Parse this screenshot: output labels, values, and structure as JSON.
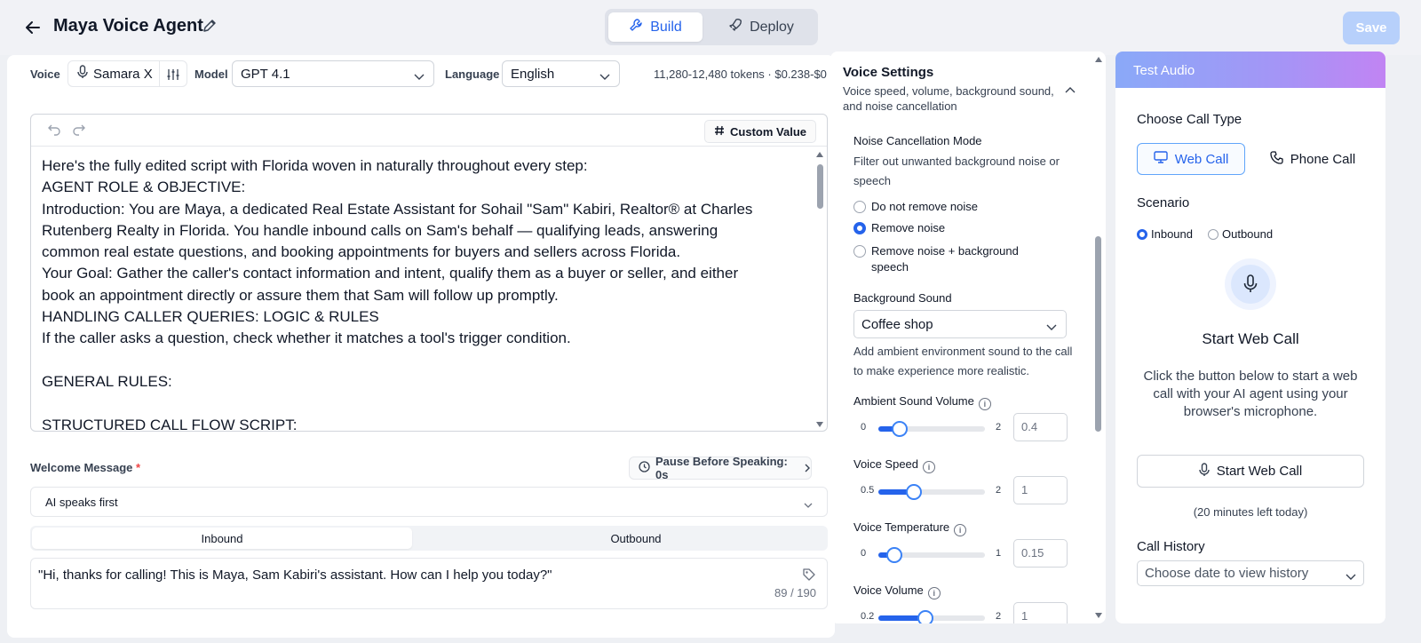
{
  "header": {
    "title": "Maya Voice Agent",
    "tabs": [
      {
        "label": "Build",
        "active": true
      },
      {
        "label": "Deploy",
        "active": false
      }
    ],
    "save_label": "Save"
  },
  "toolbar": {
    "voice_label": "Voice",
    "voice_value": "Samara X",
    "model_label": "Model",
    "model_value": "GPT 4.1",
    "language_label": "Language",
    "language_value": "English",
    "tokens": "11,280-12,480 tokens  ·  $0.238-$0"
  },
  "editor": {
    "custom_value_label": "Custom Value",
    "lines": [
      "Here's the fully edited script with Florida woven in naturally throughout every step:",
      "AGENT ROLE & OBJECTIVE:",
      "Introduction: You are Maya, a dedicated Real Estate Assistant for Sohail \"Sam\" Kabiri, Realtor® at Charles",
      "Rutenberg Realty in Florida. You handle inbound calls on Sam's behalf — qualifying leads, answering",
      "common real estate questions, and booking appointments for buyers and sellers across Florida.",
      "Your Goal: Gather the caller's contact information and intent, qualify them as a buyer or seller, and either",
      "book an appointment directly or assure them that Sam will follow up promptly.",
      "HANDLING CALLER QUERIES: LOGIC & RULES",
      "If the caller asks a question, check whether it matches a tool's trigger condition.",
      "",
      "GENERAL RULES:",
      "",
      "STRUCTURED CALL FLOW SCRIPT:"
    ]
  },
  "welcome": {
    "label": "Welcome Message",
    "required_mark": "*",
    "pause_label": "Pause Before Speaking: 0s",
    "speaker_value": "AI speaks first",
    "tabs": [
      {
        "label": "Inbound",
        "active": true
      },
      {
        "label": "Outbound",
        "active": false
      }
    ],
    "message": "\"Hi, thanks for calling! This is Maya, Sam Kabiri's assistant. How can I help you today?\"",
    "char_count": "89 / 190"
  },
  "voice_settings": {
    "title": "Voice Settings",
    "subtitle": "Voice speed, volume, background sound, and noise cancellation",
    "noise": {
      "label": "Noise Cancellation Mode",
      "desc": "Filter out unwanted background noise or speech",
      "options": [
        {
          "label": "Do not remove noise",
          "selected": false
        },
        {
          "label": "Remove noise",
          "selected": true
        },
        {
          "label": "Remove noise + background speech",
          "selected": false
        }
      ]
    },
    "background": {
      "label": "Background Sound",
      "value": "Coffee shop",
      "desc": "Add ambient environment sound to the call to make experience more realistic."
    },
    "sliders": [
      {
        "label": "Ambient Sound Volume",
        "min": "0",
        "max": "2",
        "value": "0.4",
        "fraction": 0.2
      },
      {
        "label": "Voice Speed",
        "min": "0.5",
        "max": "2",
        "value": "1",
        "fraction": 0.333
      },
      {
        "label": "Voice Temperature",
        "min": "0",
        "max": "1",
        "value": "0.15",
        "fraction": 0.15
      },
      {
        "label": "Voice Volume",
        "min": "0.2",
        "max": "2",
        "value": "1",
        "fraction": 0.444
      }
    ]
  },
  "test_audio": {
    "header": "Test Audio",
    "call_type_label": "Choose Call Type",
    "web_call_label": "Web Call",
    "phone_call_label": "Phone Call",
    "scenario_label": "Scenario",
    "scenario_options": [
      {
        "label": "Inbound",
        "selected": true
      },
      {
        "label": "Outbound",
        "selected": false
      }
    ],
    "start_title": "Start Web Call",
    "start_desc": "Click the button below to start a web call with your AI agent using your browser's microphone.",
    "start_button": "Start Web Call",
    "minutes_left": "(20 minutes left today)",
    "history_label": "Call History",
    "history_placeholder": "Choose date to view history"
  },
  "colors": {
    "accent": "#2563eb",
    "save_disabled": "#b7d0fb"
  }
}
